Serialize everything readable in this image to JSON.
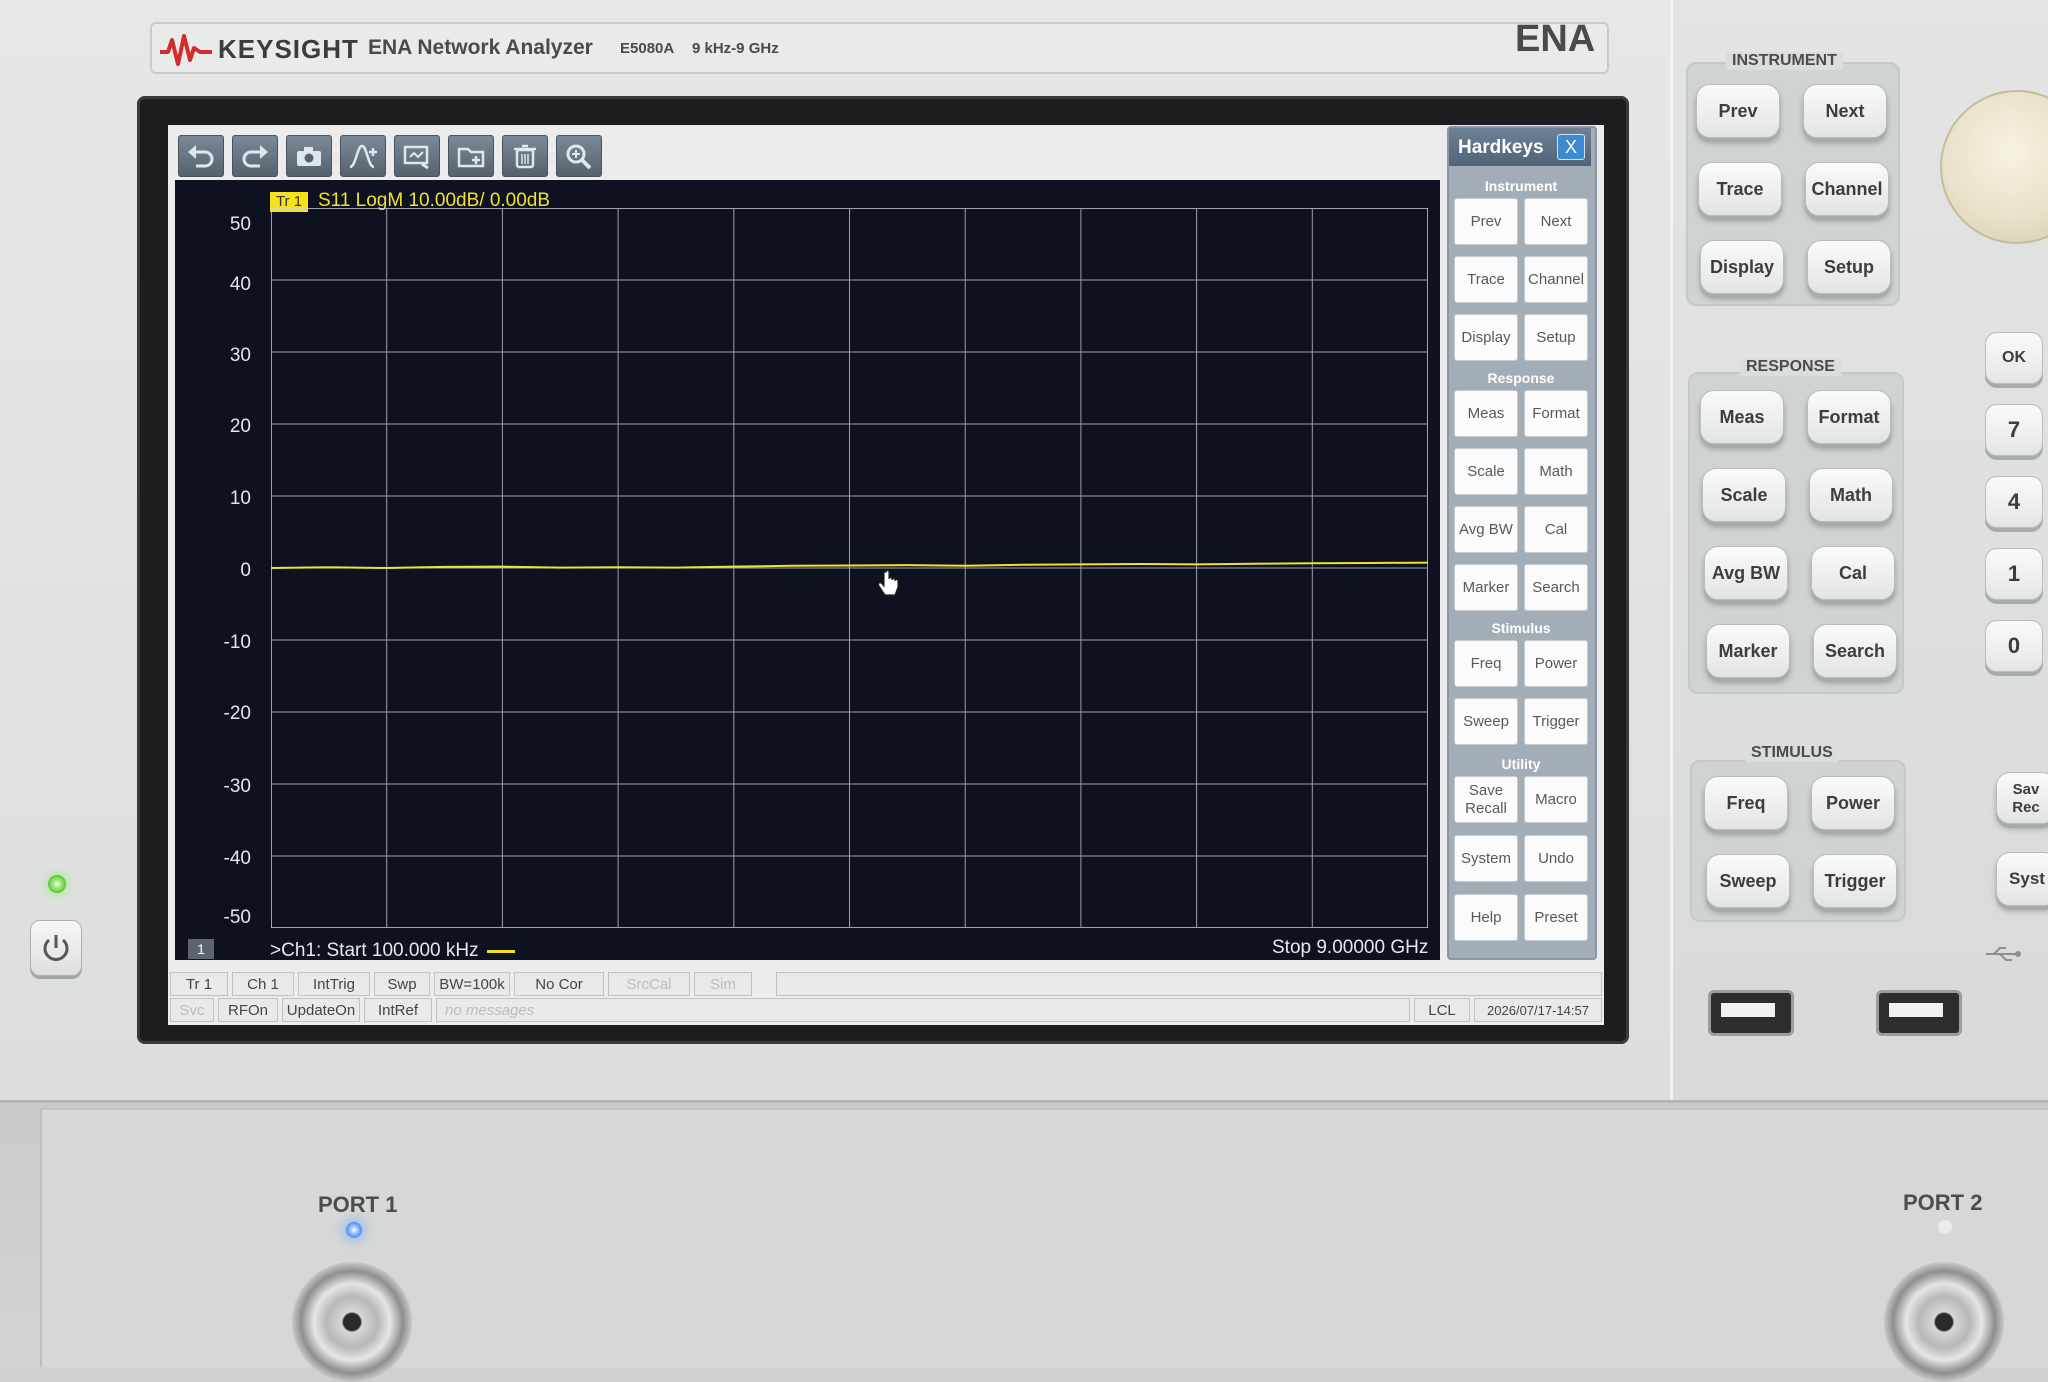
{
  "header": {
    "brand": "KEYSIGHT",
    "product": "ENA Network Analyzer",
    "model": "E5080A",
    "range": "9 kHz-9 GHz",
    "series": "ENA"
  },
  "toolbar": {
    "icons": [
      "undo-icon",
      "redo-icon",
      "camera-icon",
      "marker-icon",
      "screenshot-icon",
      "folder-icon",
      "trash-icon",
      "zoom-icon"
    ]
  },
  "trace": {
    "badge": "Tr 1",
    "label": "S11 LogM 10.00dB/  0.00dB",
    "color": "#f3e22a"
  },
  "chart_data": {
    "type": "line",
    "title": "",
    "xlabel": "",
    "ylabel": "",
    "y_ticks": [
      "50",
      "40",
      "30",
      "20",
      "10",
      "0",
      "-10",
      "-20",
      "-30",
      "-40",
      "-50"
    ],
    "ylim": [
      -50,
      50
    ],
    "xlim_label": [
      "Start 100.000 kHz",
      "Stop 9.00000 GHz"
    ],
    "grid": true,
    "series": [
      {
        "name": "S11",
        "x_fraction": [
          0,
          0.05,
          0.1,
          0.15,
          0.2,
          0.25,
          0.3,
          0.35,
          0.4,
          0.45,
          0.5,
          0.55,
          0.6,
          0.65,
          0.7,
          0.75,
          0.8,
          0.85,
          0.9,
          0.95,
          1.0
        ],
        "values": [
          0.0,
          0.1,
          0.0,
          0.15,
          0.2,
          0.05,
          0.1,
          0.05,
          0.2,
          0.3,
          0.35,
          0.4,
          0.3,
          0.45,
          0.5,
          0.55,
          0.5,
          0.6,
          0.65,
          0.7,
          0.75
        ]
      }
    ]
  },
  "stimulus": {
    "channel_badge": "1",
    "start": ">Ch1:  Start   100.000 kHz",
    "stop": "Stop  9.00000 GHz"
  },
  "hardkeys": {
    "title": "Hardkeys",
    "close": "X",
    "sections": [
      {
        "name": "Instrument",
        "buttons": [
          "Prev",
          "Next",
          "Trace",
          "Channel",
          "Display",
          "Setup"
        ]
      },
      {
        "name": "Response",
        "buttons": [
          "Meas",
          "Format",
          "Scale",
          "Math",
          "Avg BW",
          "Cal",
          "Marker",
          "Search"
        ]
      },
      {
        "name": "Stimulus",
        "buttons": [
          "Freq",
          "Power",
          "Sweep",
          "Trigger"
        ]
      },
      {
        "name": "Utility",
        "buttons": [
          "Save Recall",
          "Macro",
          "System",
          "Undo",
          "Help",
          "Preset"
        ]
      }
    ]
  },
  "statusbar": {
    "row1": [
      "Tr 1",
      "Ch 1",
      "IntTrig",
      "Swp",
      "BW=100k",
      "No Cor",
      "SrcCal",
      "Sim"
    ],
    "row2": [
      "Svc",
      "RFOn",
      "UpdateOn",
      "IntRef",
      "no messages"
    ],
    "lcl": "LCL",
    "datetime": "2026/07/17-14:57"
  },
  "front_panel": {
    "instrument_title": "INSTRUMENT",
    "instrument_keys": [
      "Prev",
      "Next",
      "Trace",
      "Channel",
      "Display",
      "Setup"
    ],
    "response_title": "RESPONSE",
    "response_keys": [
      "Meas",
      "Format",
      "Scale",
      "Math",
      "Avg BW",
      "Cal",
      "Marker",
      "Search"
    ],
    "stimulus_title": "STIMULUS",
    "stimulus_keys": [
      "Freq",
      "Power",
      "Sweep",
      "Trigger"
    ],
    "numeric_keys": [
      "OK",
      "7",
      "4",
      "1",
      "0"
    ],
    "partial_keys": [
      "Sav\nRec",
      "Syst"
    ],
    "port1": "PORT 1",
    "port2": "PORT 2"
  }
}
